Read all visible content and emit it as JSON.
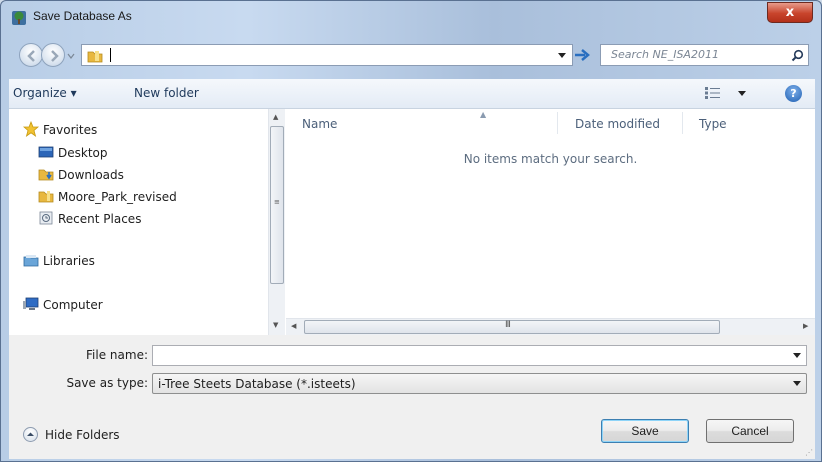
{
  "window": {
    "title": "Save Database As",
    "close_label": "x"
  },
  "address_bar": {
    "path": ""
  },
  "search": {
    "placeholder": "Search NE_ISA2011"
  },
  "toolbar": {
    "organize_label": "Organize ▾",
    "new_folder_label": "New folder",
    "help_label": "?"
  },
  "nav_pane": {
    "favorites": "Favorites",
    "items": [
      {
        "label": "Desktop",
        "icon": "desktop-icon"
      },
      {
        "label": "Downloads",
        "icon": "downloads-folder-icon"
      },
      {
        "label": "Moore_Park_revised",
        "icon": "folder-icon"
      },
      {
        "label": "Recent Places",
        "icon": "recent-places-icon"
      }
    ],
    "libraries": "Libraries",
    "computer": "Computer"
  },
  "file_list": {
    "columns": [
      "Name",
      "Date modified",
      "Type"
    ],
    "empty_message": "No items match your search.",
    "h_scroll_grip": "III"
  },
  "form": {
    "file_name_label": "File name:",
    "file_name_value": "",
    "save_type_label": "Save as type:",
    "save_type_value": "i-Tree Steets Database (*.isteets)"
  },
  "footer": {
    "hide_folders_label": "Hide Folders",
    "save_label": "Save",
    "cancel_label": "Cancel"
  },
  "colors": {
    "accent": "#1e5fb2",
    "close": "#c8442c",
    "link_text": "#1e395b"
  }
}
